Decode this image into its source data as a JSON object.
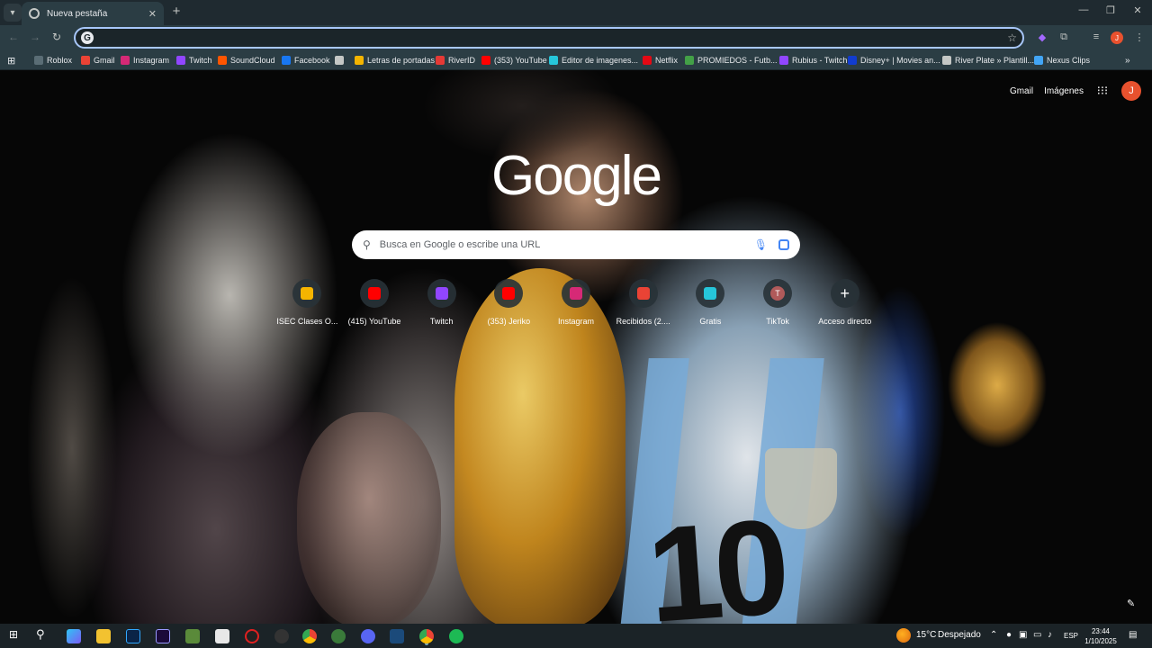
{
  "browser": {
    "tab_title": "Nueva pestaña",
    "omnibox_value": "",
    "bookmarks": [
      {
        "label": "Roblox",
        "icon": "roblox-icon",
        "color": "#5a6d75"
      },
      {
        "label": "Gmail",
        "icon": "gmail-icon",
        "color": "#ea4335"
      },
      {
        "label": "Instagram",
        "icon": "instagram-icon",
        "color": "#d62976"
      },
      {
        "label": "Twitch",
        "icon": "twitch-icon",
        "color": "#9146ff"
      },
      {
        "label": "SoundCloud",
        "icon": "soundcloud-icon",
        "color": "#ff5500"
      },
      {
        "label": "Facebook",
        "icon": "facebook-icon",
        "color": "#1877f2"
      },
      {
        "label": "",
        "icon": "globe-icon",
        "color": "#c4c7c5"
      },
      {
        "label": "Letras de portadas",
        "icon": "edit-icon",
        "color": "#f4b400"
      },
      {
        "label": "RiverID",
        "icon": "riverid-icon",
        "color": "#e53935"
      },
      {
        "label": "(353) YouTube",
        "icon": "youtube-icon",
        "color": "#ff0000"
      },
      {
        "label": "Editor de imagenes...",
        "icon": "editor-icon",
        "color": "#26c6da"
      },
      {
        "label": "Netflix",
        "icon": "netflix-icon",
        "color": "#e50914"
      },
      {
        "label": "PROMIEDOS - Futb...",
        "icon": "promiedos-icon",
        "color": "#43a047"
      },
      {
        "label": "Rubius - Twitch",
        "icon": "twitch-icon",
        "color": "#9146ff"
      },
      {
        "label": "Disney+ | Movies an...",
        "icon": "disney-icon",
        "color": "#113ccf"
      },
      {
        "label": "River Plate » Plantill...",
        "icon": "globe-icon",
        "color": "#c4c7c5"
      },
      {
        "label": "Nexus Clips",
        "icon": "nexus-icon",
        "color": "#42a5f5"
      }
    ]
  },
  "newtab": {
    "gmail_label": "Gmail",
    "images_label": "Imágenes",
    "avatar_letter": "J",
    "logo_text": "Google",
    "search_placeholder": "Busca en Google o escribe una URL",
    "shortcuts": [
      {
        "label": "ISEC Clases O...",
        "icon": "folder-icon",
        "color": "#f4b400"
      },
      {
        "label": "(415) YouTube",
        "icon": "youtube-icon",
        "color": "#ff0000"
      },
      {
        "label": "Twitch",
        "icon": "twitch-icon",
        "color": "#9146ff"
      },
      {
        "label": "(353) Jeriko",
        "icon": "youtube-icon",
        "color": "#ff0000"
      },
      {
        "label": "Instagram",
        "icon": "instagram-icon",
        "color": "#d62976"
      },
      {
        "label": "Recibidos (2....",
        "icon": "gmail-icon",
        "color": "#ea4335"
      },
      {
        "label": "Gratis",
        "icon": "edge-icon",
        "color": "#26c6da"
      },
      {
        "label": "TikTok",
        "icon": "tiktok-letter-icon",
        "color": "#b05a5a",
        "letter": "T"
      },
      {
        "label": "Acceso directo",
        "icon": "plus-icon",
        "color": "#ffffff"
      }
    ]
  },
  "taskbar": {
    "weather_temp": "15°C",
    "weather_text": "Despejado",
    "language": "ESP",
    "time": "23:44",
    "date": "1/10/2025"
  }
}
